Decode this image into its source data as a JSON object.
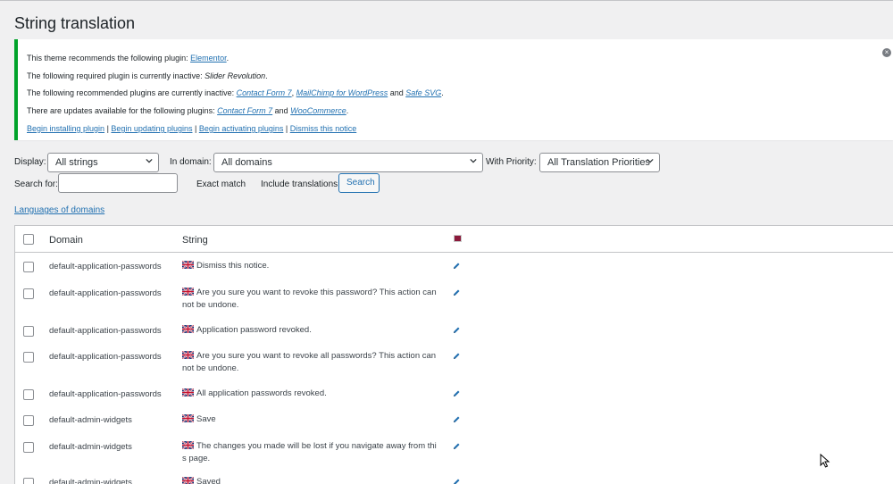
{
  "page_title": "String translation",
  "notice": {
    "line1_prefix": "This theme recommends the following plugin: ",
    "line1_link": "Elementor",
    "line1_suffix": ".",
    "line2_prefix": "The following required plugin is currently inactive: ",
    "line2_em": "Slider Revolution",
    "line2_suffix": ".",
    "line3_prefix": "The following recommended plugins are currently inactive: ",
    "line3_link1": "Contact Form 7",
    "line3_sep1": ", ",
    "line3_link2": "MailChimp for WordPress",
    "line3_and": " and ",
    "line3_link3": "Safe SVG",
    "line3_suffix": ".",
    "line4_prefix": "There are updates available for the following plugins: ",
    "line4_link1": "Contact Form 7",
    "line4_and": " and ",
    "line4_link2": "WooCommerce",
    "line4_suffix": ".",
    "actions": [
      "Begin installing plugin",
      "Begin updating plugins",
      "Begin activating plugins",
      "Dismiss this notice"
    ],
    "action_sep": " | ",
    "dismiss_icon": "×"
  },
  "filters": {
    "display_label": "Display:",
    "display_value": "All strings",
    "domain_label": "In domain:",
    "domain_value": "All domains",
    "priority_label": "With Priority:",
    "priority_value": "All Translation Priorities",
    "search_label": "Search for:",
    "search_value": "",
    "exact_match_label": "Exact match",
    "include_translations_label": "Include translations",
    "search_button": "Search"
  },
  "languages_link": "Languages of domains",
  "table": {
    "col_domain": "Domain",
    "col_string": "String",
    "rows": [
      {
        "domain": "default-application-passwords",
        "string": "Dismiss this notice."
      },
      {
        "domain": "default-application-passwords",
        "string": "Are you sure you want to revoke this password? This action cannot be undone."
      },
      {
        "domain": "default-application-passwords",
        "string": "Application password revoked."
      },
      {
        "domain": "default-application-passwords",
        "string": "Are you sure you want to revoke all passwords? This action cannot be undone."
      },
      {
        "domain": "default-application-passwords",
        "string": "All application passwords revoked."
      },
      {
        "domain": "default-admin-widgets",
        "string": "Save"
      },
      {
        "domain": "default-admin-widgets",
        "string": "The changes you made will be lost if you navigate away from this page."
      },
      {
        "domain": "default-admin-widgets",
        "string": "Saved"
      }
    ]
  },
  "colors": {
    "accent": "#2271b1",
    "notice_border": "#00a32a",
    "language_flag": "#8b1a3b"
  }
}
